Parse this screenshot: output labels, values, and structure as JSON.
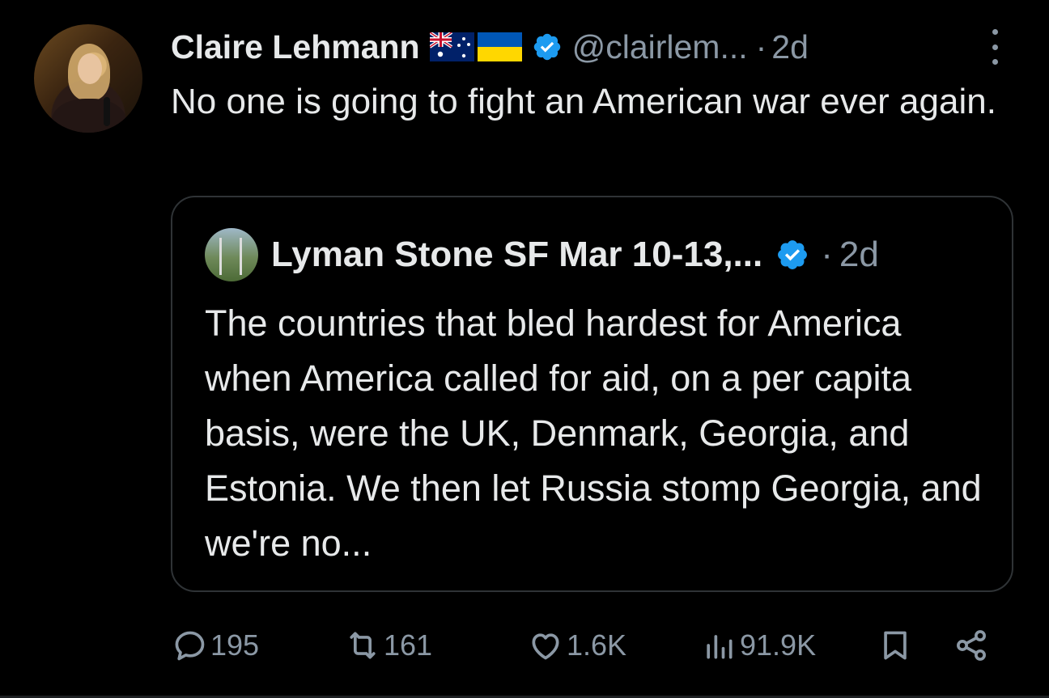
{
  "tweet": {
    "author_name": "Claire Lehmann",
    "flags": [
      "australia-flag",
      "ukraine-flag"
    ],
    "handle": "@clairlem...",
    "separator": "·",
    "time": "2d",
    "text": "No one is going to fight an American war ever again."
  },
  "quoted_tweet": {
    "author_name": "Lyman Stone SF Mar 10-13,...",
    "separator": "·",
    "time": "2d",
    "text": "The countries that bled hardest for America when America called for aid, on a per capita basis, were the UK, Denmark, Georgia, and Estonia. We then let Russia stomp Georgia, and we're no..."
  },
  "actions": {
    "replies": "195",
    "reposts": "161",
    "likes": "1.6K",
    "views": "91.9K"
  },
  "colors": {
    "background": "#000000",
    "text": "#e7e9ea",
    "muted": "#8b98a5",
    "verified": "#1d9bf0",
    "border": "#2f3336"
  }
}
